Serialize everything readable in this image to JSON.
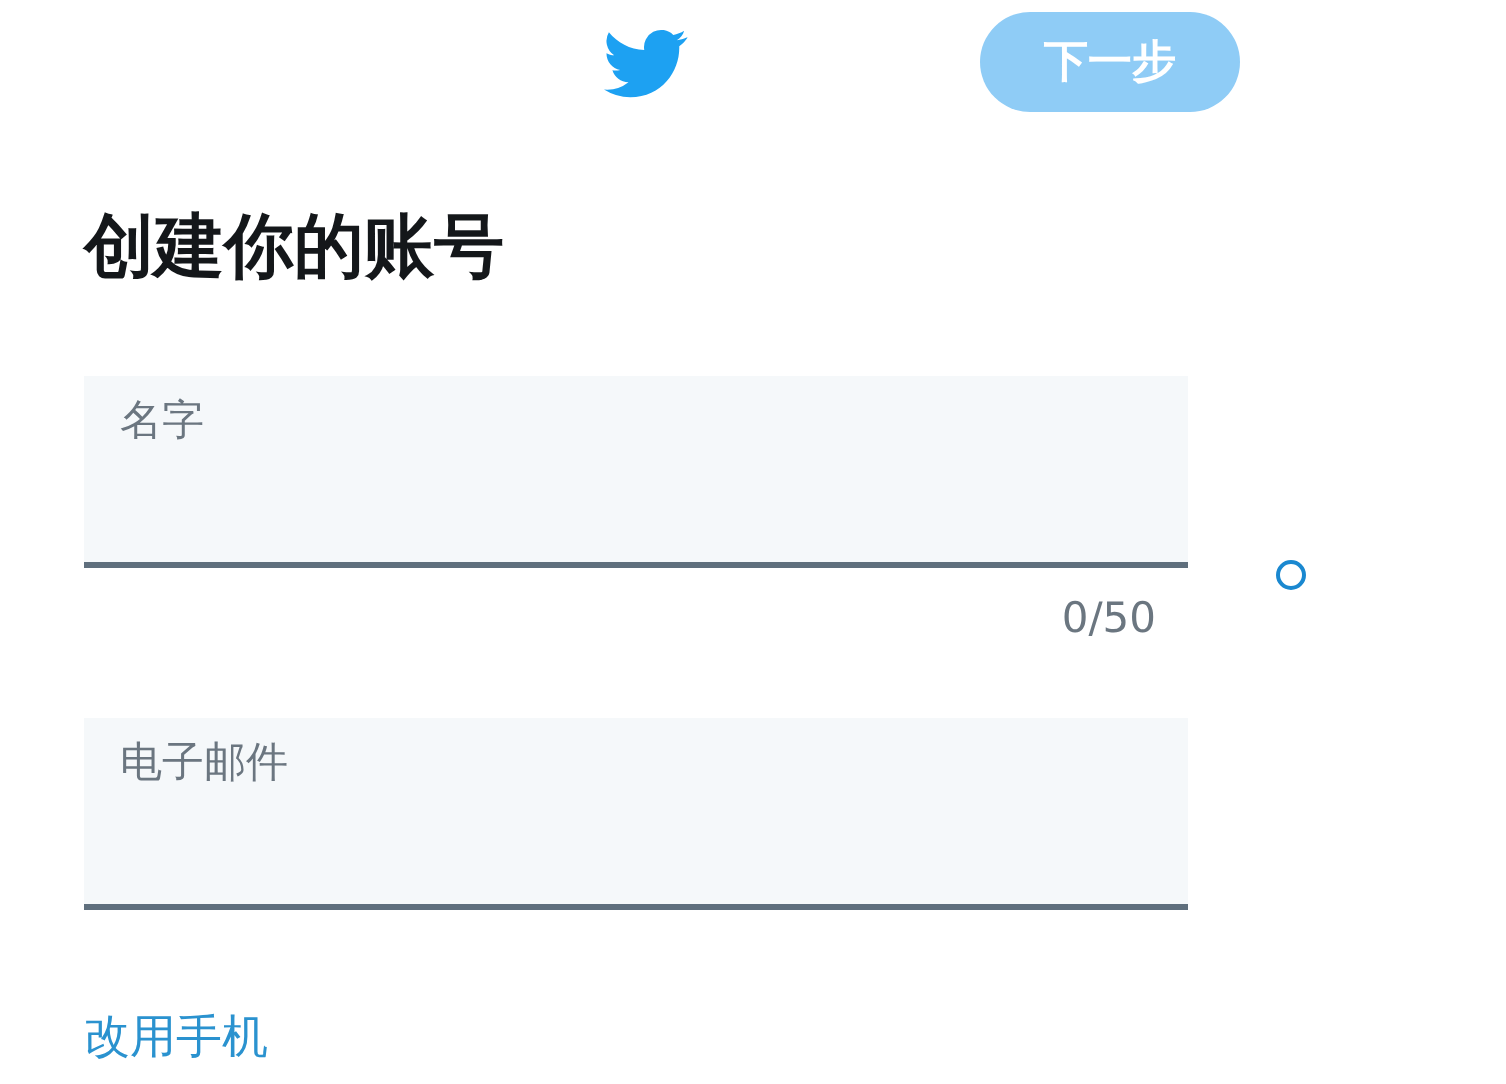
{
  "header": {
    "next_button": "下一步",
    "next_disabled": true
  },
  "title": "创建你的账号",
  "fields": [
    {
      "placeholder": "名字",
      "counter": "0/50"
    },
    {
      "placeholder": "电子邮件"
    }
  ],
  "switch_link": "改用手机"
}
